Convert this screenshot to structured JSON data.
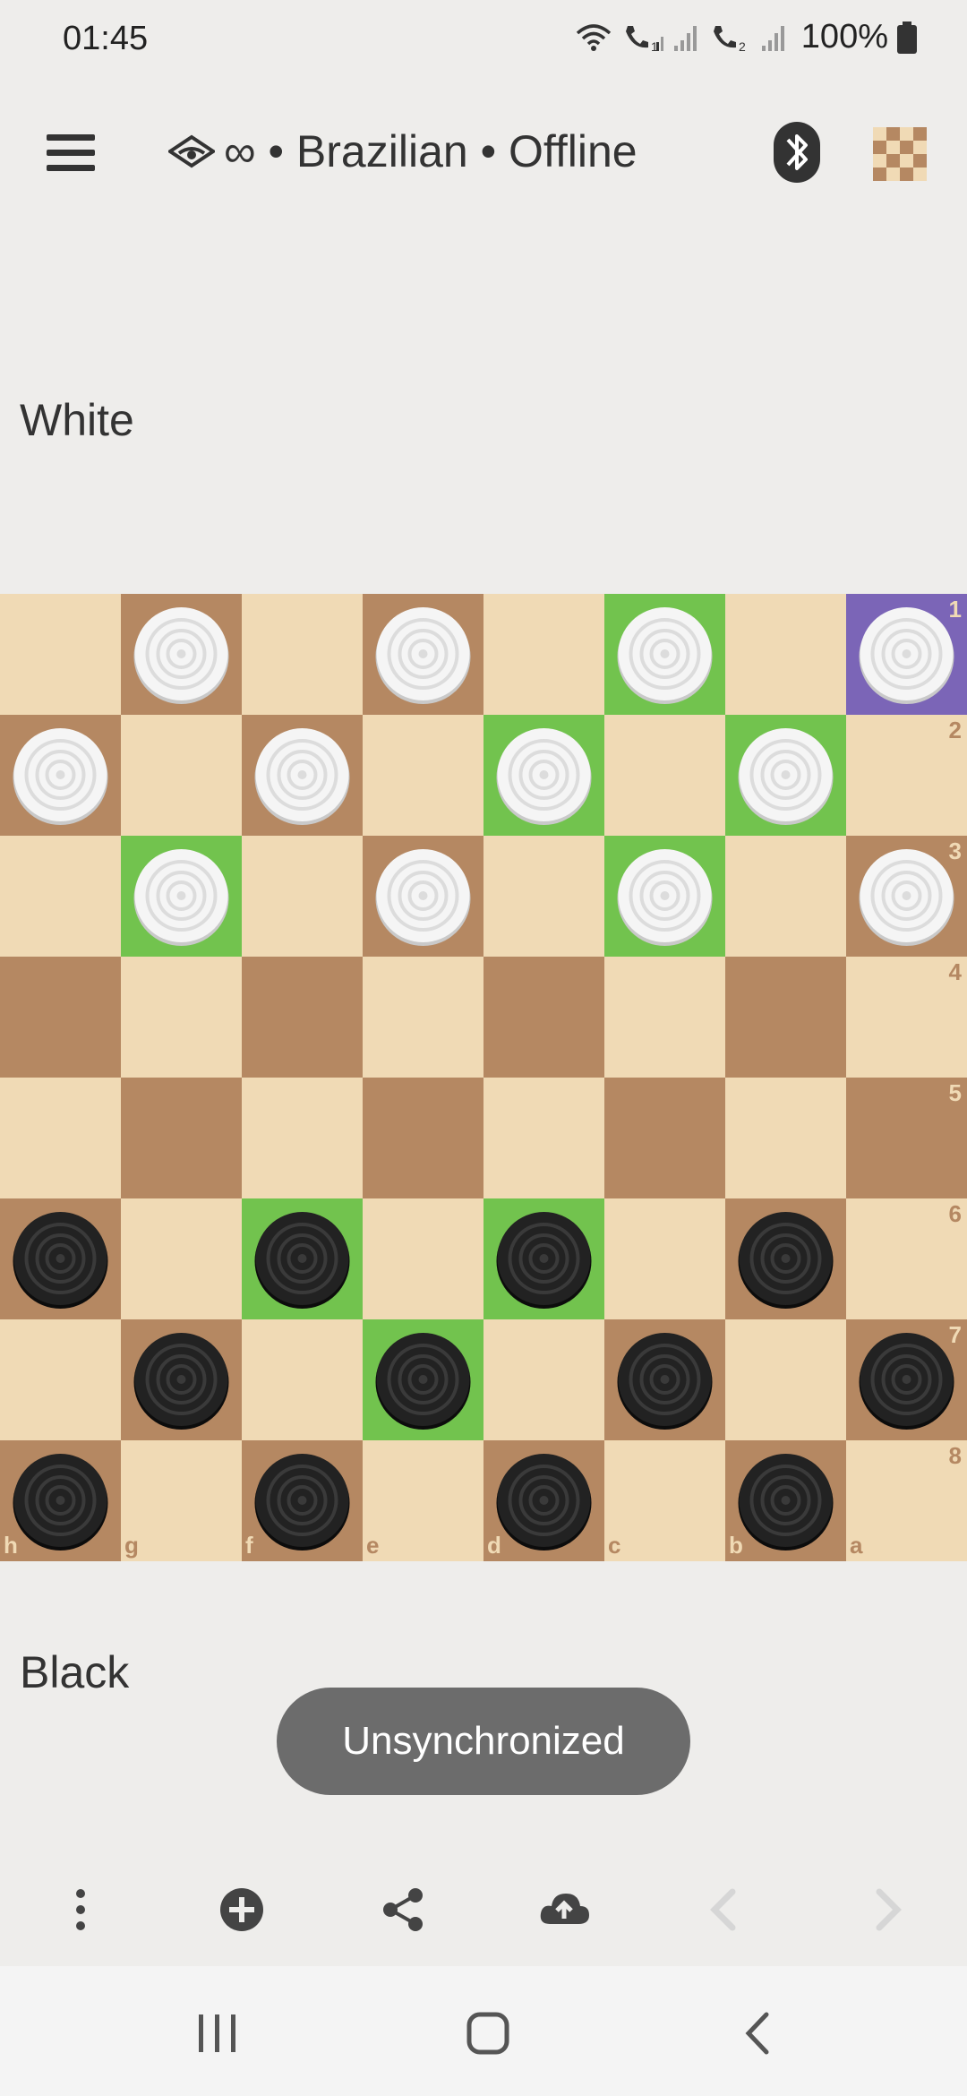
{
  "status": {
    "time": "01:45",
    "battery": "100%"
  },
  "header": {
    "title": "∞ • Brazilian • Offline",
    "icons": [
      "menu-icon",
      "brazilian-variant-icon",
      "bluetooth-icon",
      "board-theme-icon"
    ]
  },
  "players": {
    "top": "White",
    "bottom": "Black"
  },
  "board": {
    "ranks": [
      "1",
      "2",
      "3",
      "4",
      "5",
      "6",
      "7",
      "8"
    ],
    "files": [
      "h",
      "g",
      "f",
      "e",
      "d",
      "c",
      "b",
      "a"
    ],
    "light_color": "#f0dab5",
    "dark_color": "#b58862",
    "highlight_color": "#72c34e",
    "selected_color": "#7b65b7",
    "rows": [
      [
        "",
        "w",
        "",
        "w",
        "",
        "w",
        "",
        "w"
      ],
      [
        "w",
        "",
        "w",
        "",
        "w",
        "",
        "w",
        ""
      ],
      [
        "",
        "w",
        "",
        "w",
        "",
        "w",
        "",
        "w"
      ],
      [
        "",
        "",
        "",
        "",
        "",
        "",
        "",
        ""
      ],
      [
        "",
        "",
        "",
        "",
        "",
        "",
        "",
        ""
      ],
      [
        "b",
        "",
        "b",
        "",
        "b",
        "",
        "b",
        ""
      ],
      [
        "",
        "b",
        "",
        "b",
        "",
        "b",
        "",
        "b"
      ],
      [
        "b",
        "",
        "b",
        "",
        "b",
        "",
        "b",
        ""
      ]
    ],
    "highlights": [
      [
        0,
        5
      ],
      [
        1,
        4
      ],
      [
        1,
        6
      ],
      [
        2,
        1
      ],
      [
        2,
        5
      ],
      [
        5,
        2
      ],
      [
        5,
        4
      ],
      [
        6,
        3
      ]
    ],
    "selected": [
      [
        0,
        7
      ]
    ]
  },
  "toast": {
    "text": "Unsynchronized"
  },
  "toolbar": {
    "items": [
      "more-options-icon",
      "add-icon",
      "share-icon",
      "cloud-upload-icon",
      "previous-move-icon",
      "next-move-icon"
    ]
  },
  "navbar": {
    "items": [
      "recent-apps-icon",
      "home-icon",
      "back-icon"
    ]
  }
}
